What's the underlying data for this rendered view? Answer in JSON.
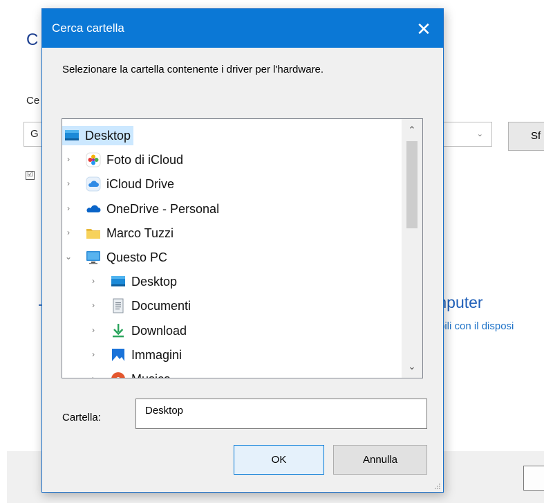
{
  "background_window": {
    "title_fragment": "C",
    "label_fragment": "Ce",
    "combo_fragment": "G",
    "browse_fragment": "Sf",
    "checkbox_mark": "☑",
    "link_title_fragment": "mputer",
    "link_desc_fragment": "bili con il disposi"
  },
  "dialog": {
    "title": "Cerca cartella",
    "close_glyph": "✕",
    "instructions": "Selezionare la cartella contenente i driver per l'hardware.",
    "tree": [
      {
        "label": "Desktop",
        "icon": "desktop-icon",
        "arrow": "",
        "selected": true
      },
      {
        "label": "Foto di iCloud",
        "icon": "photos-icon",
        "arrow": "›"
      },
      {
        "label": "iCloud Drive",
        "icon": "icloud-drive-icon",
        "arrow": "›"
      },
      {
        "label": "OneDrive - Personal",
        "icon": "onedrive-icon",
        "arrow": "›"
      },
      {
        "label": "Marco Tuzzi",
        "icon": "user-folder-icon",
        "arrow": "›"
      },
      {
        "label": "Questo PC",
        "icon": "this-pc-icon",
        "arrow": "⌄"
      },
      {
        "label": "Desktop",
        "icon": "desktop-icon",
        "arrow": "›"
      },
      {
        "label": "Documenti",
        "icon": "documents-icon",
        "arrow": "›"
      },
      {
        "label": "Download",
        "icon": "download-icon",
        "arrow": "›"
      },
      {
        "label": "Immagini",
        "icon": "pictures-icon",
        "arrow": "›"
      },
      {
        "label": "Musica",
        "icon": "music-icon",
        "arrow": "›"
      }
    ],
    "scroll_up_glyph": "⌃",
    "scroll_down_glyph": "⌄",
    "folder_label": "Cartella:",
    "folder_value": "Desktop",
    "ok_label": "OK",
    "cancel_label": "Annulla"
  },
  "colors": {
    "titlebar": "#0b78d6",
    "selection": "#cce8ff",
    "link": "#1f5fb8"
  }
}
